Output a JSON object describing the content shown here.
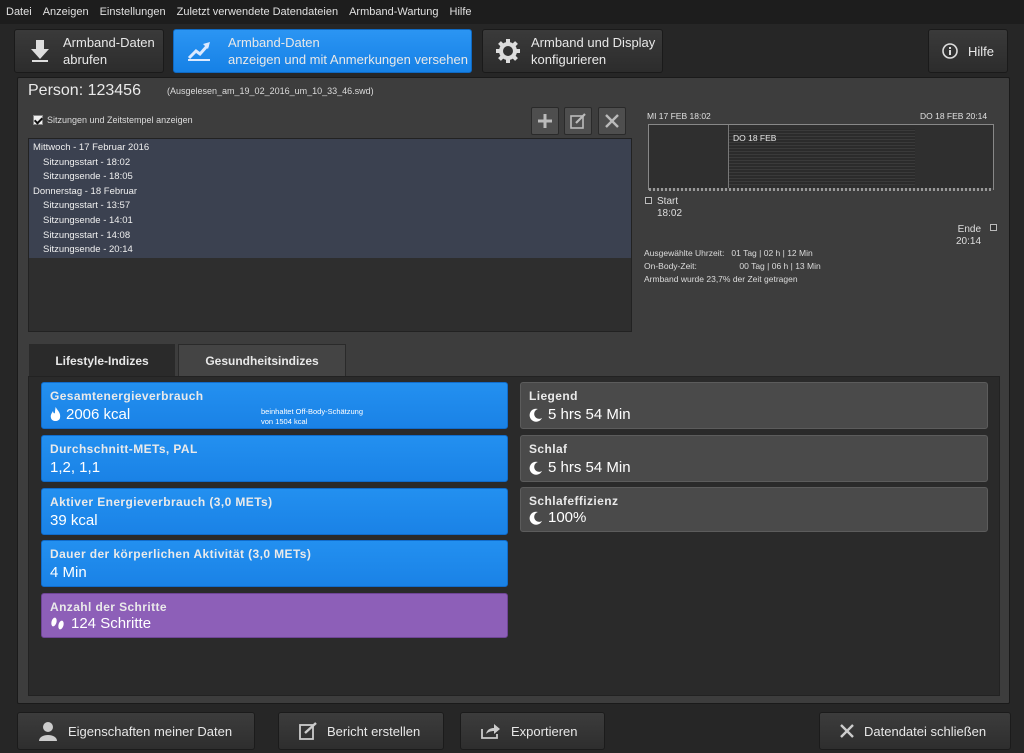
{
  "menu": [
    "Datei",
    "Anzeigen",
    "Einstellungen",
    "Zuletzt verwendete Datendateien",
    "Armband-Wartung",
    "Hilfe"
  ],
  "toolbar": {
    "fetch": {
      "line1": "Armband-Daten",
      "line2": "abrufen"
    },
    "view": {
      "line1": "Armband-Daten",
      "line2": "anzeigen und mit Anmerkungen versehen"
    },
    "configure": {
      "line1": "Armband und Display",
      "line2": "konfigurieren"
    },
    "help": "Hilfe"
  },
  "header": {
    "person": "Person: 123456",
    "filename": "(Ausgelesen_am_19_02_2016_um_10_33_46.swd)",
    "show_sessions_label": "Sitzungen und Zeitstempel anzeigen"
  },
  "sessions": [
    {
      "text": "Mittwoch - 17 Februar 2016",
      "kind": "day"
    },
    {
      "text": "Sitzungsstart  - 18:02",
      "kind": "sub"
    },
    {
      "text": "Sitzungsende  - 18:05",
      "kind": "sub"
    },
    {
      "text": "Donnerstag - 18 Februar",
      "kind": "day"
    },
    {
      "text": "Sitzungsstart  - 13:57",
      "kind": "sub"
    },
    {
      "text": "Sitzungsende  - 14:01",
      "kind": "sub"
    },
    {
      "text": "Sitzungsstart  - 14:08",
      "kind": "sub"
    },
    {
      "text": "Sitzungsende  - 20:14",
      "kind": "sub"
    }
  ],
  "timeline": {
    "left_label": "MI 17 FEB 18:02",
    "right_label": "DO 18 FEB 20:14",
    "day_label": "DO 18 FEB",
    "start": {
      "label": "Start",
      "time": "18:02"
    },
    "end": {
      "label": "Ende",
      "time": "20:14"
    },
    "selected_label": "Ausgewählte Uhrzeit:",
    "selected_value": "01 Tag | 02 h | 12 Min",
    "onbody_label": "On-Body-Zeit:",
    "onbody_value": "00 Tag | 06 h | 13 Min",
    "worn_text": "Armband wurde 23,7% der Zeit getragen"
  },
  "tabs": {
    "lifestyle": "Lifestyle-Indizes",
    "health": "Gesundheitsindizes"
  },
  "metrics": {
    "energy": {
      "title": "Gesamtenergieverbrauch",
      "value": "2006 kcal",
      "note1": "beinhaltet Off-Body-Schätzung",
      "note2": "von 1504 kcal"
    },
    "mets": {
      "title": "Durchschnitt-METs, PAL",
      "value": "1,2, 1,1"
    },
    "active_energy": {
      "title": "Aktiver Energieverbrauch (3,0 METs)",
      "value": "39 kcal"
    },
    "activity_duration": {
      "title": "Dauer der körperlichen Aktivität (3,0 METs)",
      "value": "4 Min"
    },
    "steps": {
      "title": "Anzahl der Schritte",
      "value": "124 Schritte"
    },
    "lying": {
      "title": "Liegend",
      "value": "5 hrs 54 Min"
    },
    "sleep": {
      "title": "Schlaf",
      "value": "5 hrs 54 Min"
    },
    "sleep_efficiency": {
      "title": "Schlafeffizienz",
      "value": "100%"
    }
  },
  "footer": {
    "properties": "Eigenschaften meiner Daten",
    "report": "Bericht erstellen",
    "export": "Exportieren",
    "close": "Datendatei schließen"
  },
  "colors": {
    "accent": "#1a82e6",
    "purple": "#8d5fb8",
    "background": "#262626"
  }
}
